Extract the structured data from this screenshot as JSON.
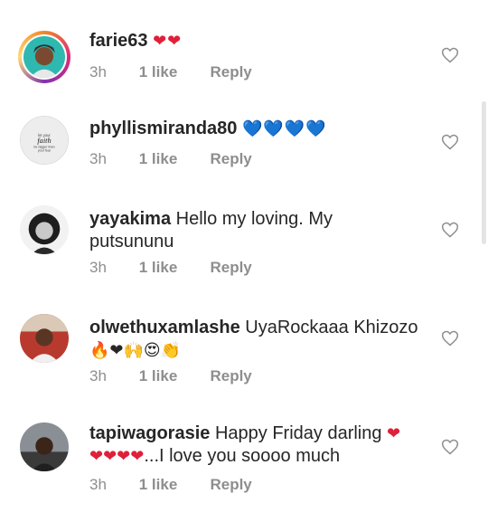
{
  "comments": [
    {
      "username": "farie63",
      "text": "",
      "emoji": "❤❤",
      "emoji_color": "#e0203a",
      "time": "3h",
      "likes": "1 like",
      "reply": "Reply"
    },
    {
      "username": "phyllismiranda80",
      "text": "",
      "emoji": "💙💙💙💙",
      "emoji_color": "#1e88e5",
      "time": "3h",
      "likes": "1 like",
      "reply": "Reply",
      "avatar_text": "let your faith be bigger than your fear"
    },
    {
      "username": "yayakima",
      "text": "Hello my loving. My",
      "text_line2": "putsununu",
      "time": "3h",
      "likes": "1 like",
      "reply": "Reply"
    },
    {
      "username": "olwethuxamlashe",
      "text": "UyaRockaaa Khizozo",
      "emoji_line2": "🔥❤🙌😍👏",
      "time": "3h",
      "likes": "1 like",
      "reply": "Reply"
    },
    {
      "username": "tapiwagorasie",
      "text": "Happy Friday darling",
      "emoji_trail": "❤",
      "emoji_line2": "❤❤❤❤",
      "text_line2": "...I love you soooo much",
      "time": "3h",
      "likes": "1 like",
      "reply": "Reply"
    }
  ],
  "colors": {
    "heart_red": "#e0203a",
    "heart_blue": "#1e88e5",
    "meta_gray": "#8e8e8e"
  }
}
